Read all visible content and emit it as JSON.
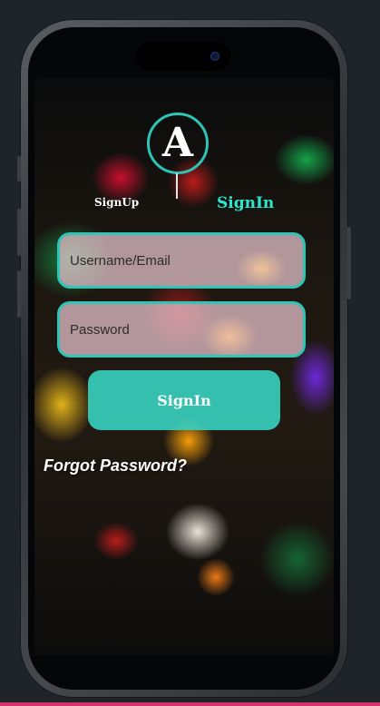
{
  "colors": {
    "accent": "#2ec4b6",
    "signin_tab": "#2ee6d0",
    "button_fill": "#38d6c4",
    "field_fill": "#ecc8d2"
  },
  "logo": {
    "letter": "A"
  },
  "tabs": {
    "signup_label": "SignUp",
    "signin_label": "SignIn"
  },
  "form": {
    "username_placeholder": "Username/Email",
    "password_placeholder": "Password",
    "submit_label": "SignIn",
    "forgot_label": "Forgot Password?"
  }
}
